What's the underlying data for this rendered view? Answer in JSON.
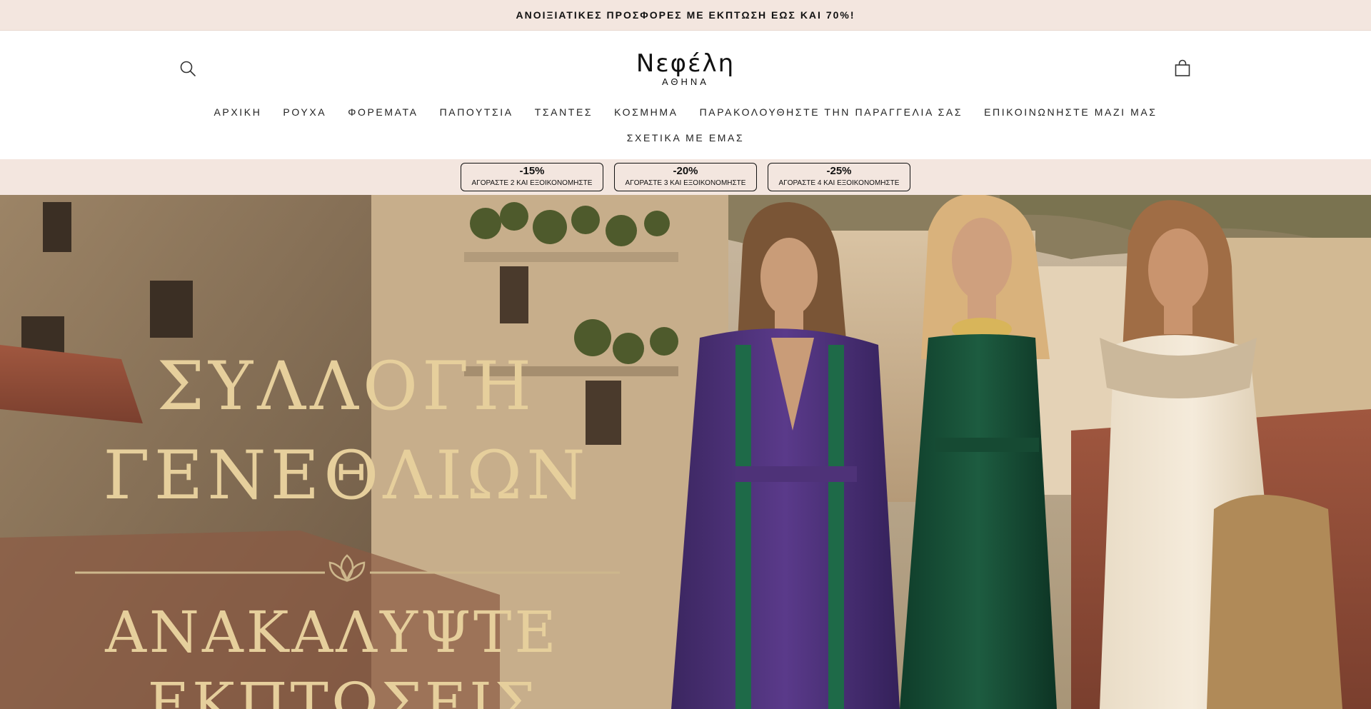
{
  "announcement": {
    "text": "ΑΝΟΙΞΙΑΤΙΚΕΣ ΠΡΟΣΦΟΡΕΣ ΜΕ ΕΚΠΤΩΣΗ ΕΩΣ ΚΑΙ 70%!"
  },
  "header": {
    "logo_main": "Νεφέλη",
    "logo_sub": "ΑΘΗΝΑ",
    "search_icon": "search-icon",
    "cart_icon": "shopping-bag-icon"
  },
  "nav": {
    "items": [
      "ΑΡΧΙΚΗ",
      "ΡΟΥΧΑ",
      "ΦΟΡΕΜΑΤΑ",
      "ΠΑΠΟΥΤΣΙΑ",
      "ΤΣΑΝΤΕΣ",
      "ΚΟΣΜΗΜΑ",
      "ΠΑΡΑΚΟΛΟΥΘΗΣΤΕ ΤΗΝ ΠΑΡΑΓΓΕΛΙΑ ΣΑΣ",
      "ΕΠΙΚΟΙΝΩΝΗΣΤΕ ΜΑΖΙ ΜΑΣ",
      "ΣΧΕΤΙΚΑ ΜΕ ΕΜΑΣ"
    ]
  },
  "promos": [
    {
      "percent": "-15%",
      "text": "ΑΓΟΡΑΣΤΕ 2 ΚΑΙ ΕΞΟΙΚΟΝΟΜΗΣΤΕ"
    },
    {
      "percent": "-20%",
      "text": "ΑΓΟΡΑΣΤΕ 3 ΚΑΙ ΕΞΟΙΚΟΝΟΜΗΣΤΕ"
    },
    {
      "percent": "-25%",
      "text": "ΑΓΟΡΑΣΤΕ 4 ΚΑΙ ΕΞΟΙΚΟΝΟΜΗΣΤΕ"
    }
  ],
  "hero": {
    "line1": "ΣΥΛΛΟΓΗ",
    "line2": "ΓΕΝΕΘΛΙΩΝ",
    "line3": "ΑΝΑΚΑΛΥΨΤΕ",
    "line4": "ΕΚΠΤΩΣΕΙΣ"
  },
  "colors": {
    "promo_background": "#f3e6df",
    "hero_title_gold": "#e6cf9c"
  }
}
